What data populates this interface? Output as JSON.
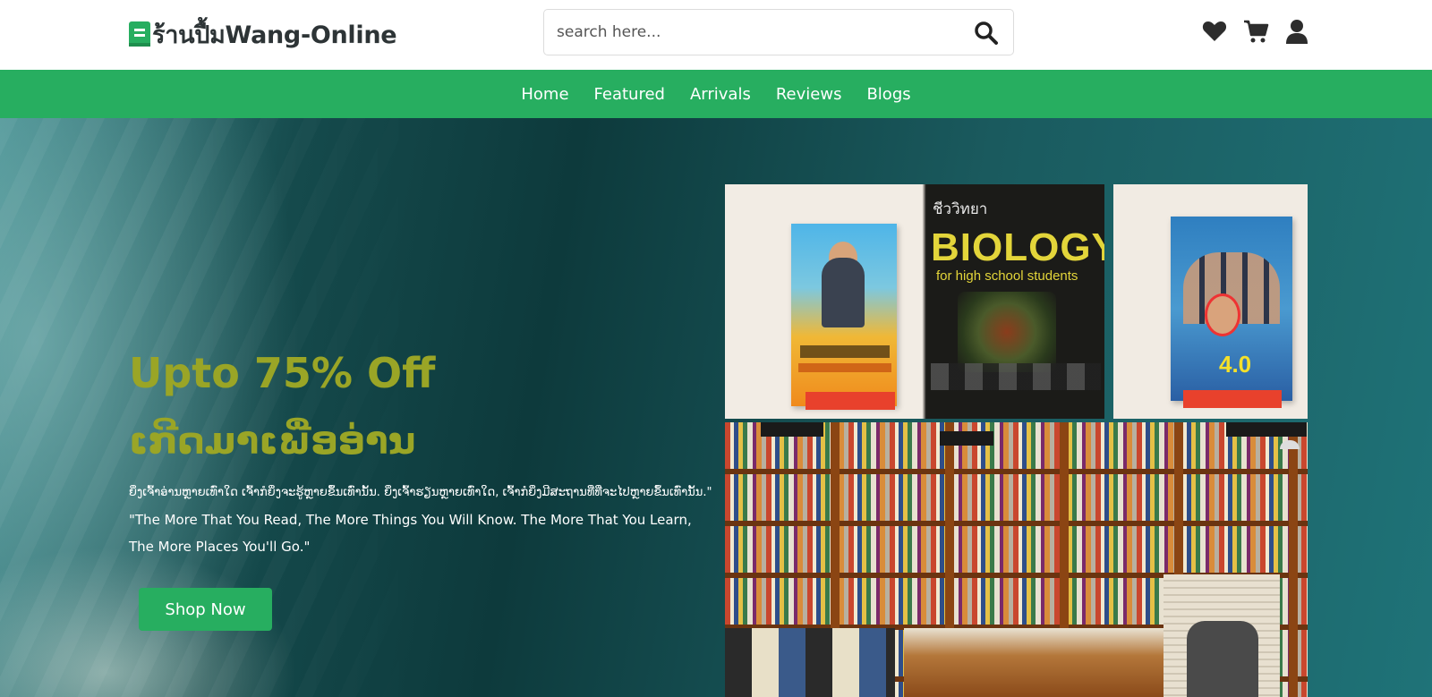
{
  "header": {
    "logo_text": "ร้านปื้มWang-Online",
    "search_placeholder": "search here...",
    "icons": [
      "heart-icon",
      "cart-icon",
      "user-icon"
    ]
  },
  "nav": {
    "items": [
      {
        "label": "Home"
      },
      {
        "label": "Featured"
      },
      {
        "label": "Arrivals"
      },
      {
        "label": "Reviews"
      },
      {
        "label": "Blogs"
      }
    ]
  },
  "hero": {
    "title": "Upto 75% Off",
    "subtitle": "ເກີດມາເພື່ອອ່ານ",
    "text_lao": "ຍິ່ງເຈົ້າອ່ານຫຼາຍເທົ່າໃດ ເຈົ້າກໍຍິ່ງຈະຮູ້ຫຼາຍຂຶ້ນເທົ່ານັ້ນ. ຍິ່ງເຈົ້າຮຽນຫຼາຍເທົ່າໃດ, ເຈົ້າກໍຍິ່ງມີສະຖານທີ່ທີ່ຈະໄປຫຼາຍຂຶ້ນເທົ່ານັ້ນ.\"",
    "text_en": "\"The More That You Read, The More Things You Will Know. The More That You Learn, The More Places You'll Go.\"",
    "button_label": "Shop Now"
  },
  "images": {
    "biology_title": "BIOLOGY",
    "biology_subtitle": "for high school students",
    "biology_top": "ชีววิทยา",
    "book2_title": "4.0"
  },
  "colors": {
    "brand_green": "#27ae60",
    "hero_title": "#9aa526",
    "hero_bg": "#154a4c"
  }
}
